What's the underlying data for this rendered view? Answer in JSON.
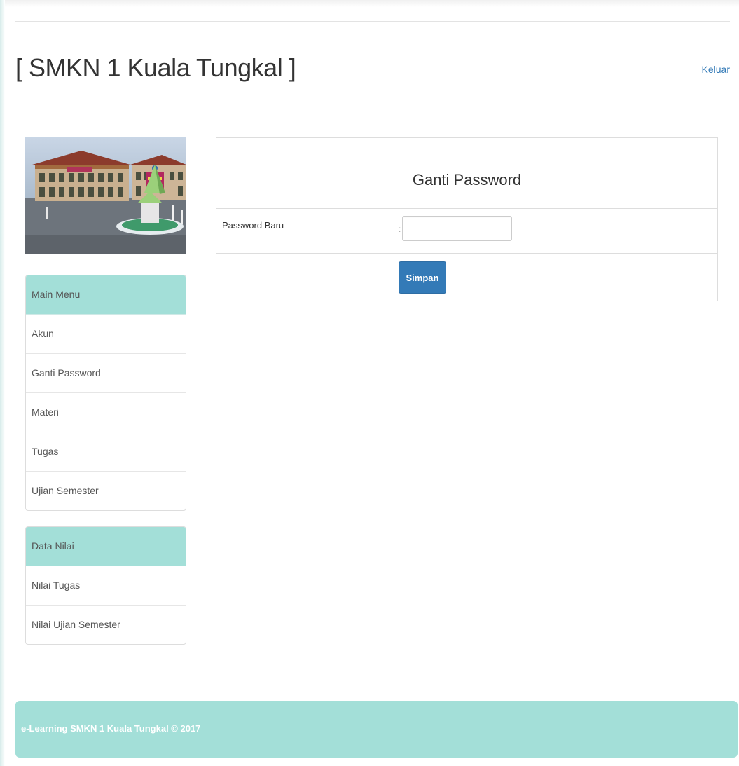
{
  "header": {
    "title": "[ SMKN 1 Kuala Tungkal ]",
    "logout_label": "Keluar"
  },
  "sidebar": {
    "photo_alt": "",
    "main_menu": {
      "heading": "Main Menu",
      "items": [
        {
          "label": "Akun"
        },
        {
          "label": "Ganti Password"
        },
        {
          "label": "Materi"
        },
        {
          "label": "Tugas"
        },
        {
          "label": "Ujian Semester"
        }
      ]
    },
    "data_nilai": {
      "heading": "Data Nilai",
      "items": [
        {
          "label": "Nilai Tugas"
        },
        {
          "label": "Nilai Ujian Semester"
        }
      ]
    }
  },
  "form": {
    "heading": "Ganti Password",
    "password_label": "Password Baru",
    "separator": ":",
    "password_value": "",
    "submit_label": "Simpan"
  },
  "footer": {
    "text": "e-Learning SMKN 1 Kuala Tungkal © 2017"
  },
  "colors": {
    "accent": "#a3dfd8",
    "primary_button": "#337ab7",
    "link": "#337ab7"
  }
}
